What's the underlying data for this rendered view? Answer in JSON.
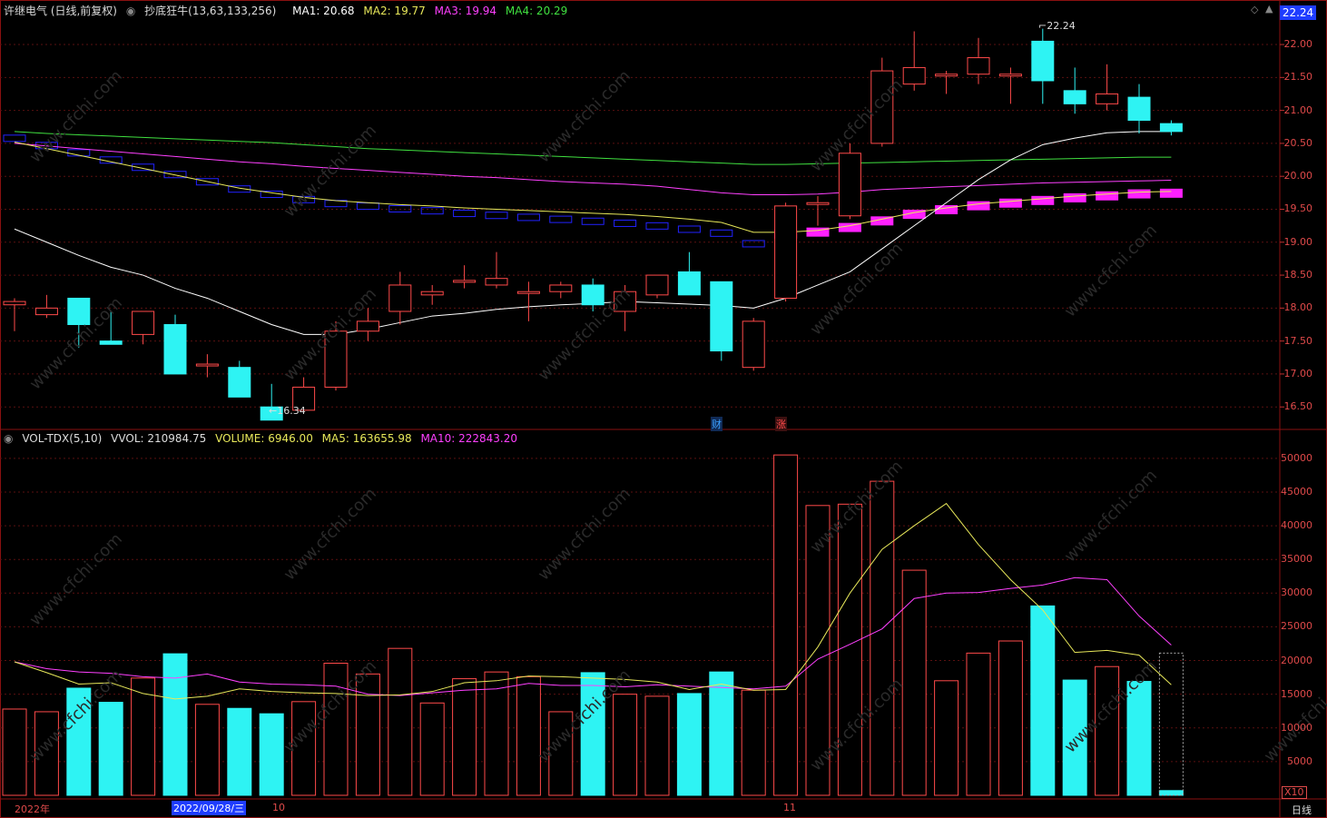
{
  "header": {
    "stock_title": "许继电气 (日线,前复权)",
    "indicator_name": "抄底狂牛(13,63,133,256)",
    "ma1": "MA1: 20.68",
    "ma2": "MA2: 19.77",
    "ma3": "MA3: 19.94",
    "ma4": "MA4: 20.29",
    "current_price": "22.24"
  },
  "vol_header": {
    "name": "VOL-TDX(5,10)",
    "vvol": "VVOL: 210984.75",
    "volume": "VOLUME: 6946.00",
    "ma5": "MA5: 163655.98",
    "ma10": "MA10: 222843.20"
  },
  "price_axis": [
    "22.00",
    "21.50",
    "21.00",
    "20.50",
    "20.00",
    "19.50",
    "19.00",
    "18.50",
    "18.00",
    "17.50",
    "17.00",
    "16.50"
  ],
  "vol_axis": [
    "50000",
    "45000",
    "40000",
    "35000",
    "30000",
    "25000",
    "20000",
    "15000",
    "10000",
    "5000"
  ],
  "vol_axis_unit": "X10",
  "markers": {
    "high": "22.24",
    "low": "16.34",
    "event1": "财",
    "event2": "涨"
  },
  "date_axis": {
    "year": "2022年",
    "cursor_date": "2022/09/28/三",
    "oct": "10",
    "nov": "11"
  },
  "period_label": "日线",
  "watermark": "www.cfchi.com",
  "colors": {
    "up": "#ff4a4a",
    "down": "#2ef3f3",
    "ma_white": "#ffffff",
    "ma_yellow": "#e8e85a",
    "ma_magenta": "#ff40ff",
    "ma_green": "#40e040",
    "step_blue": "#2222ff",
    "step_magenta": "#ff20ff"
  },
  "chart_data": {
    "type": "candlestick",
    "price_range": [
      16.2,
      22.4
    ],
    "volume_range": [
      0,
      52000
    ],
    "candles": [
      {
        "o": 18.05,
        "h": 18.15,
        "l": 17.65,
        "c": 18.1,
        "v": 12800
      },
      {
        "o": 17.9,
        "h": 18.2,
        "l": 17.85,
        "c": 18.0,
        "v": 12400
      },
      {
        "o": 18.15,
        "h": 18.15,
        "l": 17.4,
        "c": 17.75,
        "v": 15900
      },
      {
        "o": 17.5,
        "h": 17.95,
        "l": 17.45,
        "c": 17.45,
        "v": 13800
      },
      {
        "o": 17.6,
        "h": 17.95,
        "l": 17.45,
        "c": 17.95,
        "v": 17400
      },
      {
        "o": 17.75,
        "h": 17.9,
        "l": 17.0,
        "c": 17.0,
        "v": 21000
      },
      {
        "o": 17.15,
        "h": 17.3,
        "l": 16.95,
        "c": 17.15,
        "v": 13500
      },
      {
        "o": 17.1,
        "h": 17.2,
        "l": 16.65,
        "c": 16.65,
        "v": 12900
      },
      {
        "o": 16.5,
        "h": 16.85,
        "l": 16.34,
        "c": 16.3,
        "v": 12100
      },
      {
        "o": 16.45,
        "h": 16.95,
        "l": 16.45,
        "c": 16.8,
        "v": 13900
      },
      {
        "o": 16.8,
        "h": 17.8,
        "l": 16.75,
        "c": 17.65,
        "v": 19600
      },
      {
        "o": 17.65,
        "h": 18.0,
        "l": 17.5,
        "c": 17.8,
        "v": 18000
      },
      {
        "o": 17.95,
        "h": 18.55,
        "l": 17.75,
        "c": 18.35,
        "v": 21800
      },
      {
        "o": 18.2,
        "h": 18.35,
        "l": 18.05,
        "c": 18.25,
        "v": 13700
      },
      {
        "o": 18.4,
        "h": 18.65,
        "l": 18.3,
        "c": 18.42,
        "v": 17300
      },
      {
        "o": 18.35,
        "h": 18.85,
        "l": 18.3,
        "c": 18.45,
        "v": 18300
      },
      {
        "o": 18.25,
        "h": 18.4,
        "l": 17.8,
        "c": 18.25,
        "v": 17600
      },
      {
        "o": 18.25,
        "h": 18.4,
        "l": 18.15,
        "c": 18.35,
        "v": 12400
      },
      {
        "o": 18.35,
        "h": 18.45,
        "l": 17.95,
        "c": 18.05,
        "v": 18200
      },
      {
        "o": 17.95,
        "h": 18.35,
        "l": 17.65,
        "c": 18.25,
        "v": 15000
      },
      {
        "o": 18.2,
        "h": 18.5,
        "l": 18.15,
        "c": 18.5,
        "v": 14700
      },
      {
        "o": 18.55,
        "h": 18.85,
        "l": 18.2,
        "c": 18.2,
        "v": 15100
      },
      {
        "o": 18.4,
        "h": 18.4,
        "l": 17.2,
        "c": 17.35,
        "v": 18300
      },
      {
        "o": 17.1,
        "h": 17.85,
        "l": 17.05,
        "c": 17.8,
        "v": 15600
      },
      {
        "o": 18.15,
        "h": 19.6,
        "l": 18.1,
        "c": 19.55,
        "v": 50500
      },
      {
        "o": 19.6,
        "h": 19.7,
        "l": 19.25,
        "c": 19.6,
        "v": 43000
      },
      {
        "o": 19.4,
        "h": 20.5,
        "l": 19.35,
        "c": 20.35,
        "v": 43200
      },
      {
        "o": 20.5,
        "h": 21.8,
        "l": 20.45,
        "c": 21.6,
        "v": 46600
      },
      {
        "o": 21.4,
        "h": 22.2,
        "l": 21.3,
        "c": 21.65,
        "v": 33400
      },
      {
        "o": 21.55,
        "h": 21.6,
        "l": 21.25,
        "c": 21.55,
        "v": 17000
      },
      {
        "o": 21.55,
        "h": 22.1,
        "l": 21.4,
        "c": 21.8,
        "v": 21100
      },
      {
        "o": 21.55,
        "h": 21.65,
        "l": 21.1,
        "c": 21.55,
        "v": 22900
      },
      {
        "o": 22.05,
        "h": 22.24,
        "l": 21.1,
        "c": 21.45,
        "v": 28100
      },
      {
        "o": 21.3,
        "h": 21.65,
        "l": 20.95,
        "c": 21.1,
        "v": 17100
      },
      {
        "o": 21.1,
        "h": 21.7,
        "l": 21.0,
        "c": 21.25,
        "v": 19100
      },
      {
        "o": 21.2,
        "h": 21.4,
        "l": 20.65,
        "c": 20.85,
        "v": 16900
      },
      {
        "o": 20.8,
        "h": 20.85,
        "l": 20.62,
        "c": 20.68,
        "v": 700
      }
    ],
    "volume_partial_last": 21100,
    "ma_white": [
      19.2,
      19.0,
      18.8,
      18.62,
      18.5,
      18.3,
      18.15,
      17.95,
      17.75,
      17.6,
      17.6,
      17.68,
      17.78,
      17.88,
      17.92,
      17.98,
      18.02,
      18.05,
      18.07,
      18.1,
      18.08,
      18.06,
      18.04,
      18.0,
      18.15,
      18.35,
      18.55,
      18.9,
      19.25,
      19.6,
      19.95,
      20.25,
      20.48,
      20.58,
      20.66,
      20.68,
      20.68
    ],
    "ma_yellow": [
      20.52,
      20.42,
      20.32,
      20.22,
      20.12,
      20.02,
      19.92,
      19.82,
      19.75,
      19.68,
      19.63,
      19.6,
      19.57,
      19.55,
      19.52,
      19.5,
      19.48,
      19.46,
      19.44,
      19.42,
      19.39,
      19.35,
      19.3,
      19.15,
      19.15,
      19.18,
      19.25,
      19.35,
      19.45,
      19.52,
      19.58,
      19.62,
      19.66,
      19.7,
      19.73,
      19.76,
      19.77
    ],
    "ma_magenta": [
      20.5,
      20.46,
      20.42,
      20.38,
      20.34,
      20.3,
      20.26,
      20.22,
      20.19,
      20.15,
      20.12,
      20.09,
      20.06,
      20.03,
      20.0,
      19.98,
      19.95,
      19.92,
      19.9,
      19.88,
      19.85,
      19.8,
      19.75,
      19.72,
      19.72,
      19.73,
      19.76,
      19.8,
      19.82,
      19.84,
      19.86,
      19.88,
      19.9,
      19.91,
      19.92,
      19.93,
      19.94
    ],
    "ma_green": [
      20.68,
      20.65,
      20.63,
      20.61,
      20.59,
      20.57,
      20.55,
      20.53,
      20.51,
      20.48,
      20.45,
      20.42,
      20.4,
      20.38,
      20.36,
      20.34,
      20.32,
      20.3,
      20.28,
      20.26,
      20.24,
      20.22,
      20.2,
      20.18,
      20.18,
      20.19,
      20.2,
      20.21,
      20.22,
      20.23,
      20.24,
      20.25,
      20.26,
      20.27,
      20.28,
      20.29,
      20.29
    ],
    "vol_ma5": [
      19800,
      18200,
      16500,
      16700,
      15100,
      14300,
      14700,
      15800,
      15400,
      15200,
      15100,
      14800,
      14900,
      15400,
      16700,
      17000,
      17700,
      17600,
      17400,
      17200,
      16800,
      15700,
      16500,
      15600,
      15700,
      22000,
      30000,
      36500,
      40000,
      43300,
      37200,
      32000,
      27500,
      21200,
      21500,
      20800,
      16400
    ],
    "vol_ma10": [
      19800,
      18800,
      18300,
      18100,
      17600,
      17400,
      18000,
      16800,
      16500,
      16400,
      16200,
      15000,
      14800,
      15200,
      15600,
      15800,
      16600,
      16300,
      16300,
      16100,
      16400,
      16200,
      16000,
      15800,
      16200,
      20200,
      22400,
      24700,
      29200,
      30000,
      30100,
      30700,
      31200,
      32300,
      32000,
      26600,
      22300
    ]
  }
}
